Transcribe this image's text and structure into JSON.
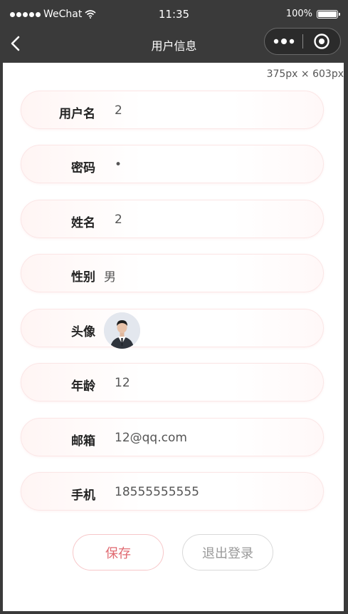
{
  "status_bar": {
    "carrier": "WeChat",
    "time": "11:35",
    "battery": "100%"
  },
  "nav": {
    "title": "用户信息",
    "back_icon": "chevron-left-icon",
    "more_icon": "more-dots-icon",
    "close_icon": "target-close-icon"
  },
  "size_label": "375px × 603px",
  "fields": [
    {
      "label": "用户名",
      "value": "2"
    },
    {
      "label": "密码",
      "value": "•"
    },
    {
      "label": "姓名",
      "value": "2"
    },
    {
      "label": "性别",
      "value": "男"
    },
    {
      "label": "头像",
      "value": ""
    },
    {
      "label": "年龄",
      "value": "12"
    },
    {
      "label": "邮箱",
      "value": "12@qq.com"
    },
    {
      "label": "手机",
      "value": "18555555555"
    }
  ],
  "buttons": {
    "save": "保存",
    "logout": "退出登录"
  },
  "colors": {
    "save_accent": "#e06a71",
    "row_border": "#fbe6e6",
    "nav_bg": "#3a3a3a"
  }
}
